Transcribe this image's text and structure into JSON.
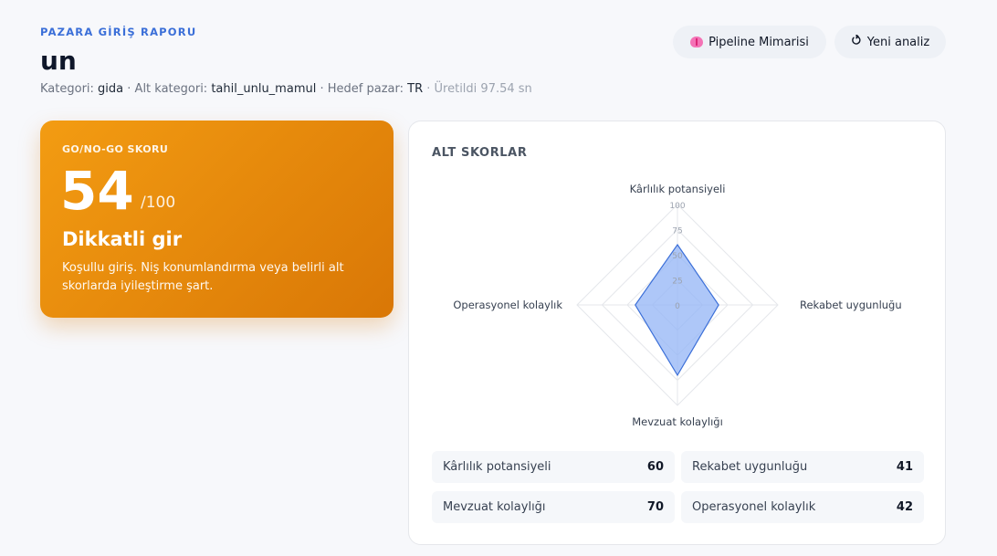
{
  "header": {
    "eyebrow": "PAZARA GİRİŞ RAPORU",
    "title": "un",
    "category_label": "Kategori:",
    "category_value": "gida",
    "subcategory_label": "Alt kategori:",
    "subcategory_value": "tahil_unlu_mamul",
    "market_label": "Hedef pazar:",
    "market_value": "TR",
    "generated": "· Üretildi 97.54 sn"
  },
  "actions": {
    "pipeline_label": "Pipeline Mimarisi",
    "pipeline_icon": "brain-icon",
    "new_label": "Yeni analiz",
    "new_icon": "refresh-icon"
  },
  "score": {
    "label": "GO/NO-GO SKORU",
    "value": "54",
    "max": "/100",
    "verdict": "Dikkatli gir",
    "description": "Koşullu giriş. Niş konumlandırma veya belirli alt skorlarda iyileştirme şart.",
    "color_start": "#f39c12",
    "color_end": "#d97706"
  },
  "subscores": {
    "title": "ALT SKORLAR",
    "items": [
      {
        "label": "Kârlılık potansiyeli",
        "value": "60"
      },
      {
        "label": "Rekabet uygunluğu",
        "value": "41"
      },
      {
        "label": "Mevzuat kolaylığı",
        "value": "70"
      },
      {
        "label": "Operasyonel kolaylık",
        "value": "42"
      }
    ]
  },
  "chart_data": {
    "type": "radar",
    "axes": [
      "Kârlılık potansiyeli",
      "Rekabet uygunluğu",
      "Mevzuat kolaylığı",
      "Operasyonel kolaylık"
    ],
    "values": [
      60,
      41,
      70,
      42
    ],
    "range": [
      0,
      100
    ],
    "ticks": [
      "0",
      "25",
      "50",
      "75",
      "100"
    ],
    "fill_color": "#93b4f5",
    "stroke_color": "#3b6fd8"
  }
}
